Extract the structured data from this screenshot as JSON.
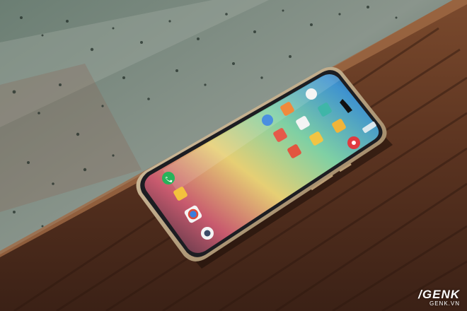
{
  "scene": {
    "description_words": "",
    "watermark": {
      "logo": "/GENK",
      "site": "GENK.VN"
    },
    "colors": {
      "window_glass": "#6f8378",
      "window_frame": "#8c8f86",
      "wood_light": "#7a4a2e",
      "wood_dark": "#3b2116",
      "phone_body": "#1c1d22",
      "phone_frame": "#c9b08a",
      "screen_blue": "#4fa8d6",
      "screen_green": "#7fd0a4",
      "screen_yellow": "#e9d37a",
      "screen_red": "#d45b6b",
      "dock_call_green": "#27b35a"
    },
    "icons": [
      "phone-call-icon",
      "folder-icon",
      "chrome-icon",
      "camera-icon",
      "gallery-icon",
      "notes-icon",
      "settings-icon",
      "store-icon",
      "music-icon",
      "weather-icon",
      "recorder-icon"
    ]
  }
}
